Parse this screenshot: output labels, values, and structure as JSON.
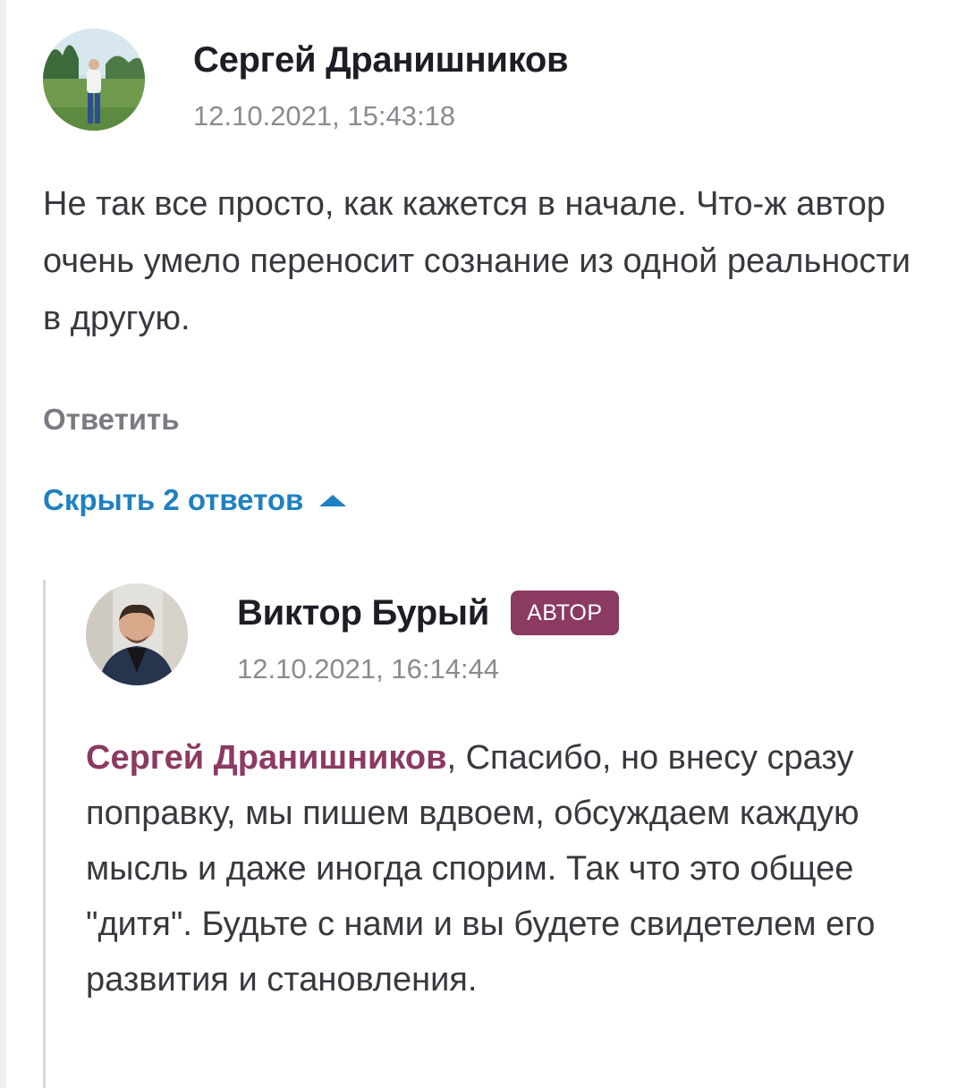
{
  "comment": {
    "author": "Сергей Дранишников",
    "timestamp": "12.10.2021, 15:43:18",
    "text": "Не так все просто, как кажется в начале. Что-ж автор очень умело переносит сознание из одной реальности в другую.",
    "reply_label": "Ответить",
    "toggle_replies_label": "Скрыть 2 ответов",
    "toggle_icon": "chevron-up-icon",
    "avatar": "user-avatar-photo"
  },
  "reply": {
    "author": "Виктор Бурый",
    "badge": "АВТОР",
    "timestamp": "12.10.2021, 16:14:44",
    "mention": "Сергей Дранишников",
    "text": ", Спасибо, но внесу сразу поправку, мы пишем вдвоем, обсуждаем каждую мысль и даже иногда спорим. Так что это общее \"дитя\". Будьте с нами и вы будете свидетелем его развития и становления.",
    "avatar": "author-avatar-photo"
  },
  "colors": {
    "link": "#1f80c1",
    "badge_bg": "#8b3a62",
    "mention": "#8b3a62",
    "muted": "#8a8a92"
  }
}
